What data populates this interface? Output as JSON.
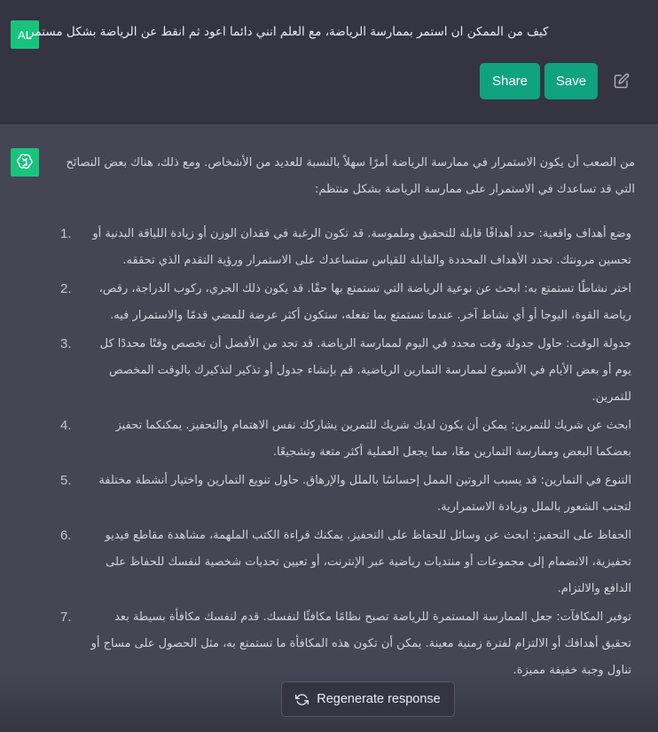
{
  "user_message": {
    "avatar_initials": "AL",
    "text": "كيف من الممكن ان استمر بممارسة الرياضة، مع العلم انني دائما اعود ثم انقط عن الرياضة بشكل مستمر"
  },
  "actions": {
    "share_label": "Share",
    "save_label": "Save"
  },
  "assistant": {
    "intro": "من الصعب أن يكون الاستمرار في ممارسة الرياضة أمرًا سهلاً بالنسبة للعديد من الأشخاص. ومع ذلك، هناك بعض النصائح التي قد تساعدك في الاستمرار على ممارسة الرياضة بشكل منتظم:",
    "items": [
      {
        "num": "1.",
        "text": "وضع أهداف واقعية: حدد أهدافًا قابلة للتحقيق وملموسة. قد تكون الرغبة في فقدان الوزن أو زيادة اللياقة البدنية أو تحسين مرونتك. تحدد الأهداف المحددة والقابلة للقياس ستساعدك على الاستمرار ورؤية التقدم الذي تحققه."
      },
      {
        "num": "2.",
        "text": "اختر نشاطًا تستمتع به: ابحث عن نوعية الرياضة التي تستمتع بها حقًا. قد يكون ذلك الجري، ركوب الدراجة، رقص، رياضة القوة، اليوجا أو أي نشاط آخر. عندما تستمتع بما تفعله، ستكون أكثر عرضة للمضي قدمًا والاستمرار فيه."
      },
      {
        "num": "3.",
        "text": "جدولة الوقت: حاول جدولة وقت محدد في اليوم لممارسة الرياضة. قد تجد من الأفضل أن تخصص وقتًا محددًا كل يوم أو بعض الأيام في الأسبوع لممارسة التمارين الرياضية. قم بإنشاء جدول أو تذكير لتذكيرك بالوقت المخصص للتمرين."
      },
      {
        "num": "4.",
        "text": "ابحث عن شريك للتمرين: يمكن أن يكون لديك شريك للتمرين يشاركك نفس الاهتمام والتحفيز. يمكنكما تحفيز بعضكما البعض وممارسة التمارين معًا، مما يجعل العملية أكثر متعة وتشجيعًا."
      },
      {
        "num": "5.",
        "text": "التنوع في التمارين: قد يسبب الروتين الممل إحساسًا بالملل والإرهاق. حاول تنويع التمارين واختيار أنشطة مختلفة لتجنب الشعور بالملل وزيادة الاستمرارية."
      },
      {
        "num": "6.",
        "text": "الحفاظ على التحفيز: ابحث عن وسائل للحفاظ على التحفيز. يمكنك قراءة الكتب الملهمة، مشاهدة مقاطع فيديو تحفيزية، الانضمام إلى مجموعات أو منتديات رياضية عبر الإنترنت، أو تعيين تحديات شخصية لنفسك للحفاظ على الدافع والالتزام."
      },
      {
        "num": "7.",
        "text": "توفير المكافآت: جعل الممارسة المستمرة للرياضة تصبح نظامًا مكافئًا لنفسك. قدم لنفسك مكافأة بسيطة بعد تحقيق أهدافك أو الالتزام لفترة زمنية معينة. يمكن أن تكون هذه المكافأة ما تستمتع به، مثل الحصول على مساج أو تناول وجبة خفيفة مميزة."
      }
    ]
  },
  "regenerate_label": "Regenerate response",
  "colors": {
    "accent": "#10a37f",
    "avatar": "#19c37d",
    "user_bg": "#343541",
    "assistant_bg": "#444654"
  }
}
